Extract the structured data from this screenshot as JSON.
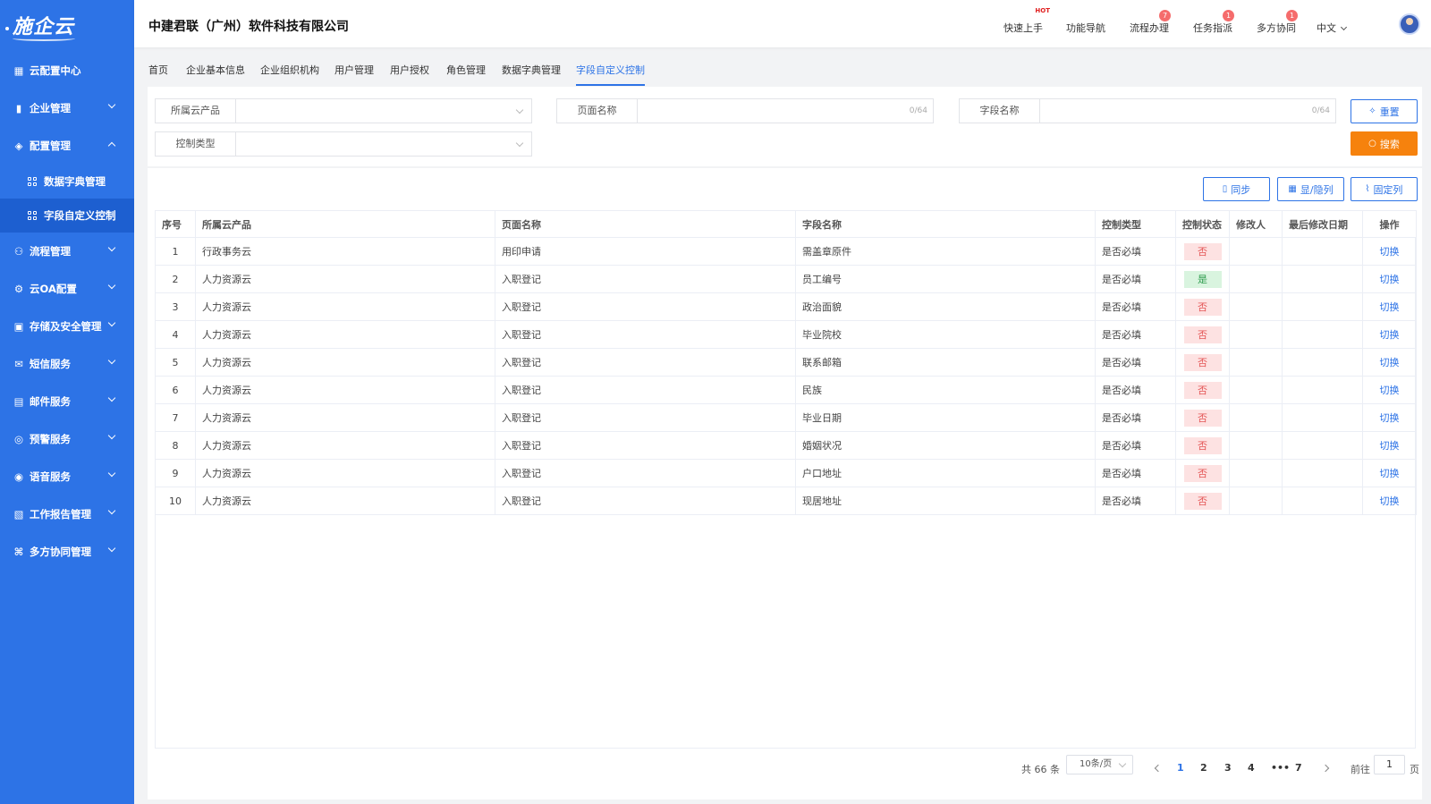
{
  "app": {
    "logo": "施企云"
  },
  "sidebar": {
    "items": [
      {
        "label": "云配置中心",
        "icon": "dashboard-icon",
        "expanded": null
      },
      {
        "label": "企业管理",
        "icon": "building-icon",
        "expanded": false
      },
      {
        "label": "配置管理",
        "icon": "layers-icon",
        "expanded": true
      },
      {
        "label": "流程管理",
        "icon": "flow-icon",
        "expanded": false
      },
      {
        "label": "云OA配置",
        "icon": "user-gear-icon",
        "expanded": false
      },
      {
        "label": "存储及安全管理",
        "icon": "storage-icon",
        "expanded": false
      },
      {
        "label": "短信服务",
        "icon": "mail-icon",
        "expanded": false
      },
      {
        "label": "邮件服务",
        "icon": "card-icon",
        "expanded": false
      },
      {
        "label": "预警服务",
        "icon": "alert-icon",
        "expanded": false
      },
      {
        "label": "语音服务",
        "icon": "voice-icon",
        "expanded": false
      },
      {
        "label": "工作报告管理",
        "icon": "report-icon",
        "expanded": false
      },
      {
        "label": "多方协同管理",
        "icon": "collab-icon",
        "expanded": false
      }
    ],
    "subitems": [
      {
        "label": "数据字典管理",
        "active": false
      },
      {
        "label": "字段自定义控制",
        "active": true
      }
    ]
  },
  "header": {
    "company": "中建君联（广州）软件科技有限公司",
    "links": [
      {
        "label": "快速上手",
        "badge": "HOT"
      },
      {
        "label": "功能导航",
        "badge": ""
      },
      {
        "label": "流程办理",
        "badge": "7"
      },
      {
        "label": "任务指派",
        "badge": "1"
      },
      {
        "label": "多方协同",
        "badge": "1"
      }
    ],
    "language": "中文"
  },
  "tabs": [
    "首页",
    "企业基本信息",
    "企业组织机构",
    "用户管理",
    "用户授权",
    "角色管理",
    "数据字典管理",
    "字段自定义控制"
  ],
  "filters": {
    "product_label": "所属云产品",
    "page_label": "页面名称",
    "page_count": "0/64",
    "field_label": "字段名称",
    "field_count": "0/64",
    "control_type_label": "控制类型",
    "reset": "重置",
    "search": "搜索"
  },
  "toolbar": {
    "sync": "同步",
    "toggle_cols": "显/隐列",
    "fix_cols": "固定列"
  },
  "table": {
    "headers": [
      "序号",
      "所属云产品",
      "页面名称",
      "字段名称",
      "控制类型",
      "控制状态",
      "修改人",
      "最后修改日期",
      "操作"
    ],
    "rows": [
      [
        "1",
        "行政事务云",
        "用印申请",
        "需盖章原件",
        "是否必填",
        "否",
        "",
        "",
        "切换"
      ],
      [
        "2",
        "人力资源云",
        "入职登记",
        "员工编号",
        "是否必填",
        "是",
        "",
        "",
        "切换"
      ],
      [
        "3",
        "人力资源云",
        "入职登记",
        "政治面貌",
        "是否必填",
        "否",
        "",
        "",
        "切换"
      ],
      [
        "4",
        "人力资源云",
        "入职登记",
        "毕业院校",
        "是否必填",
        "否",
        "",
        "",
        "切换"
      ],
      [
        "5",
        "人力资源云",
        "入职登记",
        "联系邮箱",
        "是否必填",
        "否",
        "",
        "",
        "切换"
      ],
      [
        "6",
        "人力资源云",
        "入职登记",
        "民族",
        "是否必填",
        "否",
        "",
        "",
        "切换"
      ],
      [
        "7",
        "人力资源云",
        "入职登记",
        "毕业日期",
        "是否必填",
        "否",
        "",
        "",
        "切换"
      ],
      [
        "8",
        "人力资源云",
        "入职登记",
        "婚姻状况",
        "是否必填",
        "否",
        "",
        "",
        "切换"
      ],
      [
        "9",
        "人力资源云",
        "入职登记",
        "户口地址",
        "是否必填",
        "否",
        "",
        "",
        "切换"
      ],
      [
        "10",
        "人力资源云",
        "入职登记",
        "现居地址",
        "是否必填",
        "否",
        "",
        "",
        "切换"
      ]
    ]
  },
  "pagination": {
    "total": "共 66 条",
    "page_size": "10条/页",
    "pages": [
      "1",
      "2",
      "3",
      "4",
      "•••",
      "7"
    ],
    "current": "1",
    "goto_prefix": "前往",
    "goto_value": "1",
    "goto_suffix": "页"
  },
  "colors": {
    "primary": "#2d73e6",
    "sidebar": "#2d73e6",
    "search": "#f6820d",
    "no_tag": "#fde2e2",
    "yes_tag": "#d9f4df"
  }
}
